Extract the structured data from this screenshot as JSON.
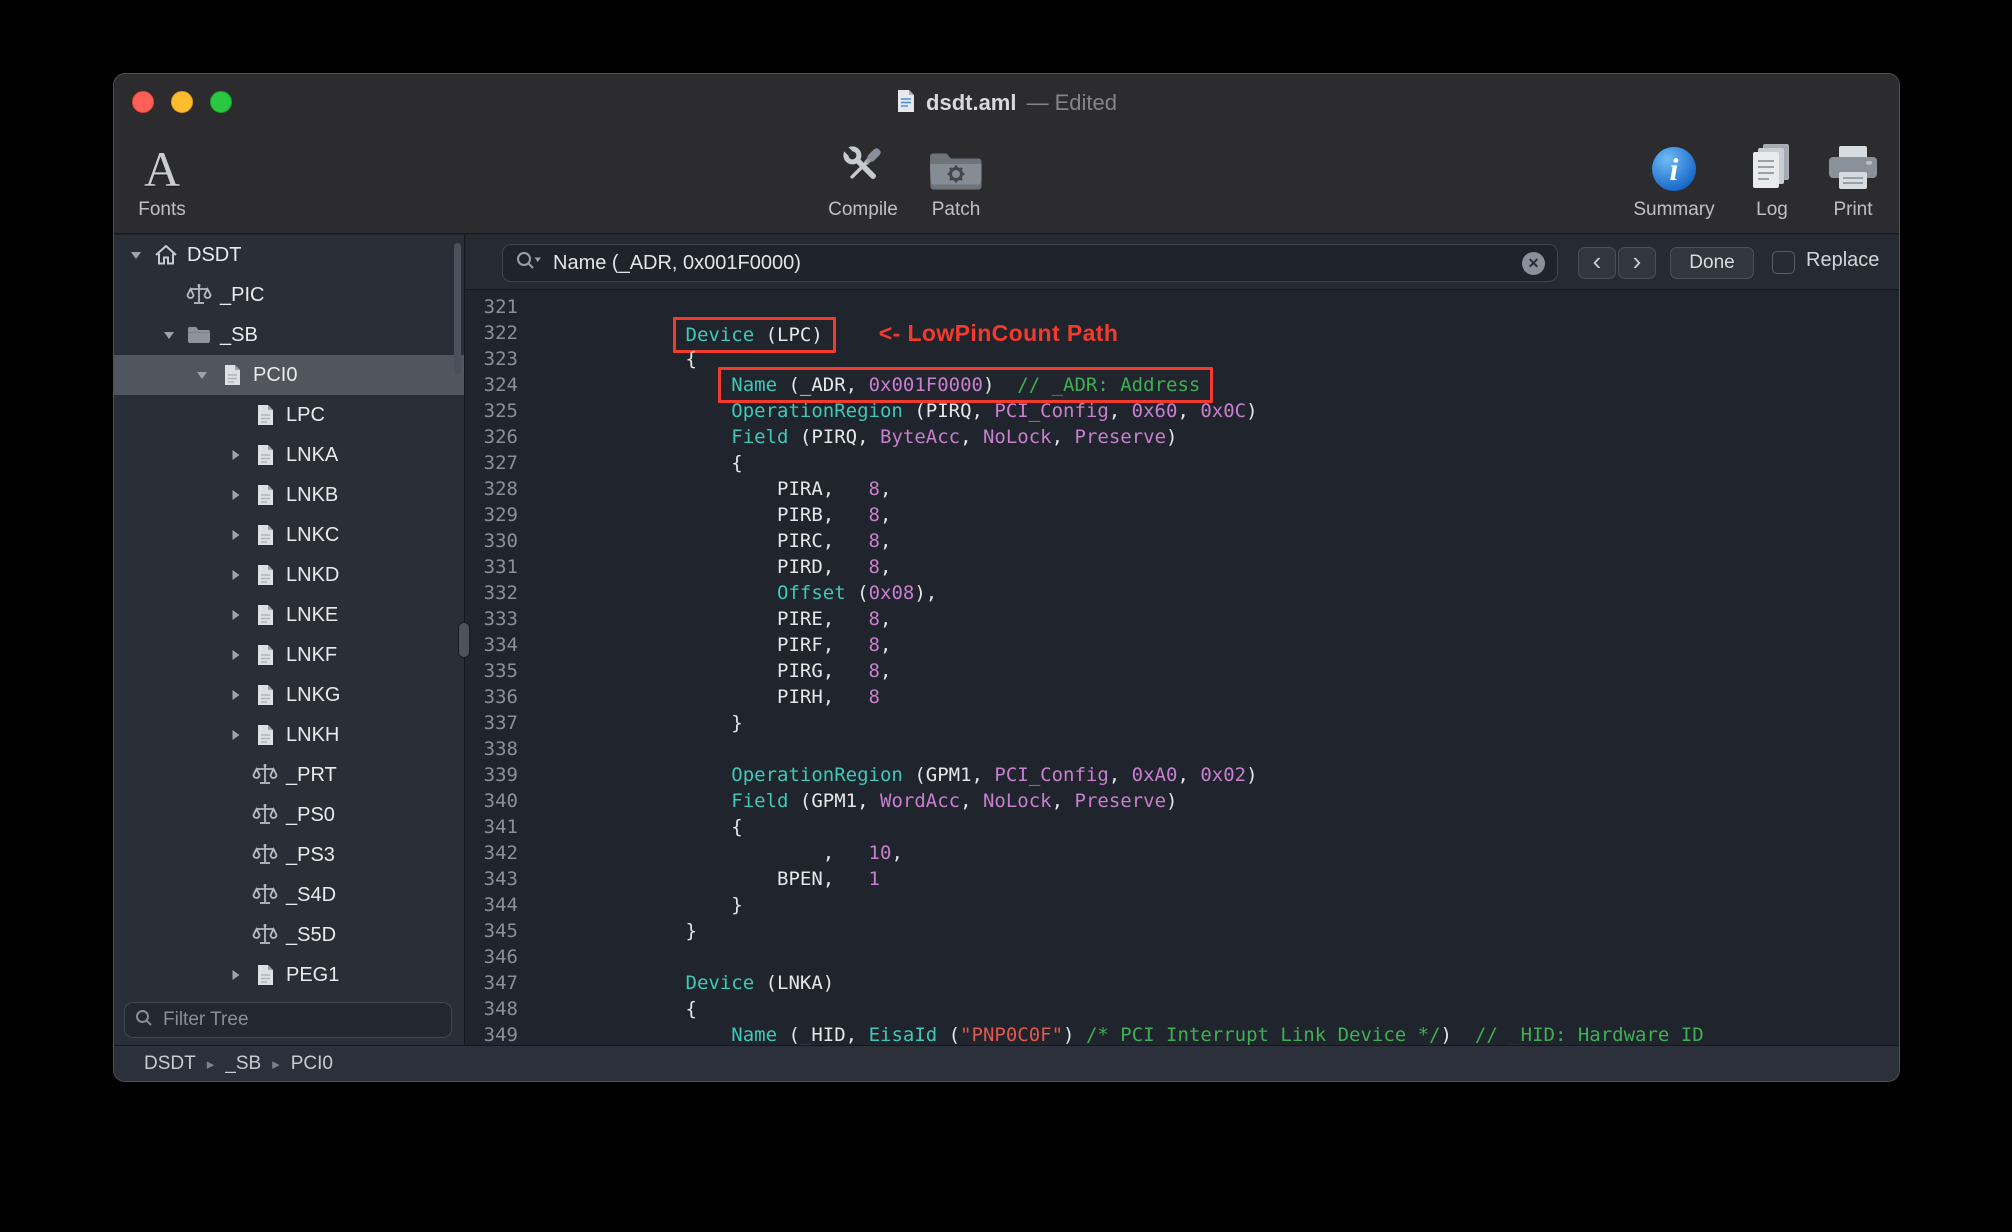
{
  "window": {
    "filename": "dsdt.aml",
    "status": "— Edited"
  },
  "toolbar": {
    "fonts": "Fonts",
    "compile": "Compile",
    "patch": "Patch",
    "summary": "Summary",
    "log": "Log",
    "print": "Print"
  },
  "sidebar": {
    "filter_placeholder": "Filter Tree",
    "tree": [
      {
        "label": "DSDT",
        "level": 0,
        "disclosure": "open",
        "icon": "home"
      },
      {
        "label": "_PIC",
        "level": 1,
        "disclosure": null,
        "icon": "scales"
      },
      {
        "label": "_SB",
        "level": 1,
        "disclosure": "open",
        "icon": "folder"
      },
      {
        "label": "PCI0",
        "level": 2,
        "disclosure": "open",
        "icon": "device",
        "selected": true
      },
      {
        "label": "LPC",
        "level": 3,
        "disclosure": null,
        "icon": "device"
      },
      {
        "label": "LNKA",
        "level": 3,
        "disclosure": "closed",
        "icon": "device"
      },
      {
        "label": "LNKB",
        "level": 3,
        "disclosure": "closed",
        "icon": "device"
      },
      {
        "label": "LNKC",
        "level": 3,
        "disclosure": "closed",
        "icon": "device"
      },
      {
        "label": "LNKD",
        "level": 3,
        "disclosure": "closed",
        "icon": "device"
      },
      {
        "label": "LNKE",
        "level": 3,
        "disclosure": "closed",
        "icon": "device"
      },
      {
        "label": "LNKF",
        "level": 3,
        "disclosure": "closed",
        "icon": "device"
      },
      {
        "label": "LNKG",
        "level": 3,
        "disclosure": "closed",
        "icon": "device"
      },
      {
        "label": "LNKH",
        "level": 3,
        "disclosure": "closed",
        "icon": "device"
      },
      {
        "label": "_PRT",
        "level": 3,
        "disclosure": null,
        "icon": "scales"
      },
      {
        "label": "_PS0",
        "level": 3,
        "disclosure": null,
        "icon": "scales"
      },
      {
        "label": "_PS3",
        "level": 3,
        "disclosure": null,
        "icon": "scales"
      },
      {
        "label": "_S4D",
        "level": 3,
        "disclosure": null,
        "icon": "scales"
      },
      {
        "label": "_S5D",
        "level": 3,
        "disclosure": null,
        "icon": "scales"
      },
      {
        "label": "PEG1",
        "level": 3,
        "disclosure": "closed",
        "icon": "device"
      }
    ]
  },
  "search": {
    "query": "Name (_ADR, 0x001F0000)",
    "clear_label": "✕",
    "prev_label": "‹",
    "next_label": "›",
    "done_label": "Done",
    "replace_label": "Replace"
  },
  "breadcrumb": {
    "separator": "▸",
    "items": [
      "DSDT",
      "_SB",
      "PCI0"
    ]
  },
  "annotation": {
    "callout": "<- LowPinCount Path"
  },
  "colors": {
    "kw": "#3FC8B7",
    "num": "#C77FCE",
    "str": "#E0594E",
    "com": "#3FAF53",
    "plain": "#E5E7EA",
    "lnum": "#8A909A",
    "red": "#F43B2B"
  },
  "code": {
    "lines": [
      {
        "num": 321,
        "tokens": []
      },
      {
        "num": 322,
        "tokens": [
          {
            "text": "        "
          },
          {
            "box": [
              {
                "text": "Device",
                "style": "kw"
              },
              {
                "text": " (LPC)"
              }
            ]
          },
          {
            "callout": "<- LowPinCount Path"
          }
        ]
      },
      {
        "num": 323,
        "tokens": [
          {
            "text": "        {"
          }
        ]
      },
      {
        "num": 324,
        "tokens": [
          {
            "text": "            "
          },
          {
            "box": [
              {
                "text": "Name",
                "style": "kw"
              },
              {
                "text": " (_ADR, "
              },
              {
                "text": "0x001F0000",
                "style": "num"
              },
              {
                "text": ")"
              },
              {
                "text": "  "
              },
              {
                "text": "// _ADR: Address",
                "style": "com"
              }
            ]
          }
        ]
      },
      {
        "num": 325,
        "tokens": [
          {
            "text": "            "
          },
          {
            "text": "OperationRegion",
            "style": "kw"
          },
          {
            "text": " (PIRQ, "
          },
          {
            "text": "PCI_Config",
            "style": "num"
          },
          {
            "text": ", "
          },
          {
            "text": "0x60",
            "style": "num"
          },
          {
            "text": ", "
          },
          {
            "text": "0x0C",
            "style": "num"
          },
          {
            "text": ")"
          }
        ]
      },
      {
        "num": 326,
        "tokens": [
          {
            "text": "            "
          },
          {
            "text": "Field",
            "style": "kw"
          },
          {
            "text": " (PIRQ, "
          },
          {
            "text": "ByteAcc",
            "style": "num"
          },
          {
            "text": ", "
          },
          {
            "text": "NoLock",
            "style": "num"
          },
          {
            "text": ", "
          },
          {
            "text": "Preserve",
            "style": "num"
          },
          {
            "text": ")"
          }
        ]
      },
      {
        "num": 327,
        "tokens": [
          {
            "text": "            {"
          }
        ]
      },
      {
        "num": 328,
        "tokens": [
          {
            "text": "                PIRA,   "
          },
          {
            "text": "8",
            "style": "num"
          },
          {
            "text": ","
          }
        ]
      },
      {
        "num": 329,
        "tokens": [
          {
            "text": "                PIRB,   "
          },
          {
            "text": "8",
            "style": "num"
          },
          {
            "text": ","
          }
        ]
      },
      {
        "num": 330,
        "tokens": [
          {
            "text": "                PIRC,   "
          },
          {
            "text": "8",
            "style": "num"
          },
          {
            "text": ","
          }
        ]
      },
      {
        "num": 331,
        "tokens": [
          {
            "text": "                PIRD,   "
          },
          {
            "text": "8",
            "style": "num"
          },
          {
            "text": ","
          }
        ]
      },
      {
        "num": 332,
        "tokens": [
          {
            "text": "                "
          },
          {
            "text": "Offset",
            "style": "kw"
          },
          {
            "text": " ("
          },
          {
            "text": "0x08",
            "style": "num"
          },
          {
            "text": "),"
          }
        ]
      },
      {
        "num": 333,
        "tokens": [
          {
            "text": "                PIRE,   "
          },
          {
            "text": "8",
            "style": "num"
          },
          {
            "text": ","
          }
        ]
      },
      {
        "num": 334,
        "tokens": [
          {
            "text": "                PIRF,   "
          },
          {
            "text": "8",
            "style": "num"
          },
          {
            "text": ","
          }
        ]
      },
      {
        "num": 335,
        "tokens": [
          {
            "text": "                PIRG,   "
          },
          {
            "text": "8",
            "style": "num"
          },
          {
            "text": ","
          }
        ]
      },
      {
        "num": 336,
        "tokens": [
          {
            "text": "                PIRH,   "
          },
          {
            "text": "8",
            "style": "num"
          }
        ]
      },
      {
        "num": 337,
        "tokens": [
          {
            "text": "            }"
          }
        ]
      },
      {
        "num": 338,
        "tokens": []
      },
      {
        "num": 339,
        "tokens": [
          {
            "text": "            "
          },
          {
            "text": "OperationRegion",
            "style": "kw"
          },
          {
            "text": " (GPM1, "
          },
          {
            "text": "PCI_Config",
            "style": "num"
          },
          {
            "text": ", "
          },
          {
            "text": "0xA0",
            "style": "num"
          },
          {
            "text": ", "
          },
          {
            "text": "0x02",
            "style": "num"
          },
          {
            "text": ")"
          }
        ]
      },
      {
        "num": 340,
        "tokens": [
          {
            "text": "            "
          },
          {
            "text": "Field",
            "style": "kw"
          },
          {
            "text": " (GPM1, "
          },
          {
            "text": "WordAcc",
            "style": "num"
          },
          {
            "text": ", "
          },
          {
            "text": "NoLock",
            "style": "num"
          },
          {
            "text": ", "
          },
          {
            "text": "Preserve",
            "style": "num"
          },
          {
            "text": ")"
          }
        ]
      },
      {
        "num": 341,
        "tokens": [
          {
            "text": "            {"
          }
        ]
      },
      {
        "num": 342,
        "tokens": [
          {
            "text": "                    ,   "
          },
          {
            "text": "10",
            "style": "num"
          },
          {
            "text": ","
          }
        ]
      },
      {
        "num": 343,
        "tokens": [
          {
            "text": "                BPEN,   "
          },
          {
            "text": "1",
            "style": "num"
          }
        ]
      },
      {
        "num": 344,
        "tokens": [
          {
            "text": "            }"
          }
        ]
      },
      {
        "num": 345,
        "tokens": [
          {
            "text": "        }"
          }
        ]
      },
      {
        "num": 346,
        "tokens": []
      },
      {
        "num": 347,
        "tokens": [
          {
            "text": "        "
          },
          {
            "text": "Device",
            "style": "kw"
          },
          {
            "text": " (LNKA)"
          }
        ]
      },
      {
        "num": 348,
        "tokens": [
          {
            "text": "        {"
          }
        ]
      },
      {
        "num": 349,
        "tokens": [
          {
            "text": "            "
          },
          {
            "text": "Name",
            "style": "kw"
          },
          {
            "text": " (_HID, "
          },
          {
            "text": "EisaId",
            "style": "kw"
          },
          {
            "text": " ("
          },
          {
            "text": "\"PNP0C0F\"",
            "style": "str"
          },
          {
            "text": ") "
          },
          {
            "text": "/* PCI Interrupt Link Device */",
            "style": "com"
          },
          {
            "text": ")  "
          },
          {
            "text": "// _HID: Hardware ID",
            "style": "com"
          }
        ]
      }
    ]
  }
}
